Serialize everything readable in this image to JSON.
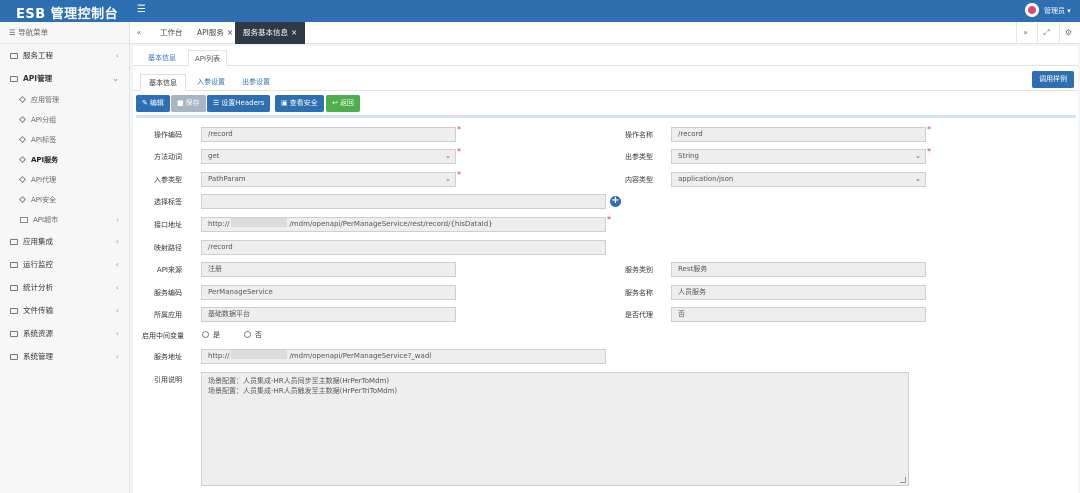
{
  "app": {
    "title": "ESB 管理控制台",
    "user": "管理员 ▾",
    "accent": "#2e6fb2"
  },
  "sidebar": {
    "header": "导航菜单",
    "items": [
      {
        "label": "服务工程"
      },
      {
        "label": "API管理"
      },
      {
        "label": "应用集成"
      },
      {
        "label": "运行监控"
      },
      {
        "label": "统计分析"
      },
      {
        "label": "文件传输"
      },
      {
        "label": "系统资源"
      },
      {
        "label": "系统管理"
      }
    ],
    "sub": [
      {
        "label": "应用管理"
      },
      {
        "label": "API分组"
      },
      {
        "label": "API标签"
      },
      {
        "label": "API服务"
      },
      {
        "label": "API代理"
      },
      {
        "label": "API安全"
      },
      {
        "label": "API超市"
      }
    ]
  },
  "tabs": [
    {
      "label": "工作台"
    },
    {
      "label": "API服务"
    },
    {
      "label": "服务基本信息"
    }
  ],
  "subtabs": [
    {
      "label": "基本信息"
    },
    {
      "label": "API列表"
    }
  ],
  "tabs2": [
    {
      "label": "基本信息"
    },
    {
      "label": "入参设置"
    },
    {
      "label": "出参设置"
    }
  ],
  "toolbar": {
    "edit": "编辑",
    "save": "保存",
    "headers": "设置Headers",
    "security": "查看安全",
    "back": "返回",
    "apidoc": "调用样例"
  },
  "form": {
    "op_code": {
      "label": "操作编码",
      "value": "/record"
    },
    "op_name": {
      "label": "操作名称",
      "value": "/record"
    },
    "method": {
      "label": "方法动词",
      "value": "get"
    },
    "out_type": {
      "label": "出参类型",
      "value": "String"
    },
    "in_type": {
      "label": "入参类型",
      "value": "PathParam"
    },
    "content_type": {
      "label": "内容类型",
      "value": "application/json"
    },
    "tags": {
      "label": "选择标签",
      "value": ""
    },
    "api_url": {
      "label": "接口地址",
      "prefix": "http://",
      "suffix": "/mdm/openapi/PerManageService/rest/record/{hisDataId}"
    },
    "map_path": {
      "label": "映射路径",
      "value": "/record"
    },
    "api_source": {
      "label": "API来源",
      "value": "注册"
    },
    "svc_category": {
      "label": "服务类别",
      "value": "Rest服务"
    },
    "svc_code": {
      "label": "服务编码",
      "value": "PerManageService"
    },
    "svc_name": {
      "label": "服务名称",
      "value": "人员服务"
    },
    "app": {
      "label": "所属应用",
      "value": "基础数据平台"
    },
    "is_proxy": {
      "label": "是否代理",
      "value": "否"
    },
    "middle_var": {
      "label": "启用中间变量",
      "opt_yes": "是",
      "opt_no": "否"
    },
    "svc_addr": {
      "label": "服务地址",
      "prefix": "http://",
      "suffix": "/mdm/openapi/PerManageService?_wadl"
    },
    "desc": {
      "label": "引用说明",
      "line1": "场景配置：人员集成-HR人员同步至主数据(HrPerToMdm)",
      "line2": "场景配置：人员集成-HR人员触发至主数据(HrPerTriToMdm)"
    }
  }
}
